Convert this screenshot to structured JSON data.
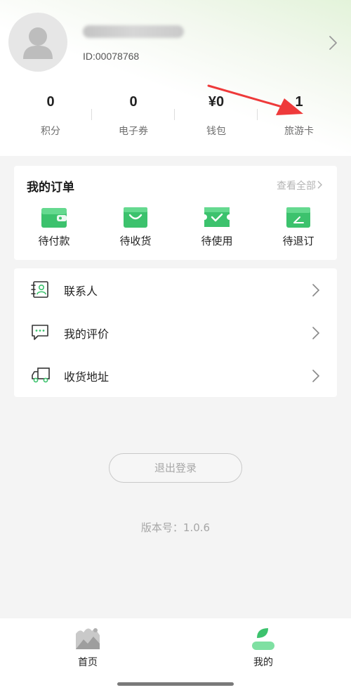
{
  "profile": {
    "user_id": "ID:00078768"
  },
  "stats": [
    {
      "value": "0",
      "label": "积分"
    },
    {
      "value": "0",
      "label": "电子券"
    },
    {
      "value": "¥0",
      "label": "钱包"
    },
    {
      "value": "1",
      "label": "旅游卡"
    }
  ],
  "orders": {
    "title": "我的订单",
    "view_all": "查看全部",
    "items": [
      {
        "label": "待付款",
        "icon": "wallet-icon"
      },
      {
        "label": "待收货",
        "icon": "shopping-bag-icon"
      },
      {
        "label": "待使用",
        "icon": "ticket-check-icon"
      },
      {
        "label": "待退订",
        "icon": "refund-box-icon"
      }
    ]
  },
  "menu": [
    {
      "label": "联系人",
      "icon": "contacts-icon"
    },
    {
      "label": "我的评价",
      "icon": "review-chat-icon"
    },
    {
      "label": "收货地址",
      "icon": "delivery-truck-icon"
    }
  ],
  "logout_label": "退出登录",
  "version_text": "版本号：1.0.6",
  "tabbar": [
    {
      "label": "首页",
      "icon": "home-mountain-icon"
    },
    {
      "label": "我的",
      "icon": "profile-leaf-icon"
    }
  ],
  "colors": {
    "accent": "#3cc26d",
    "text_primary": "#222222",
    "text_secondary": "#6f6f6f",
    "annotation_arrow": "#ee3a3a"
  }
}
